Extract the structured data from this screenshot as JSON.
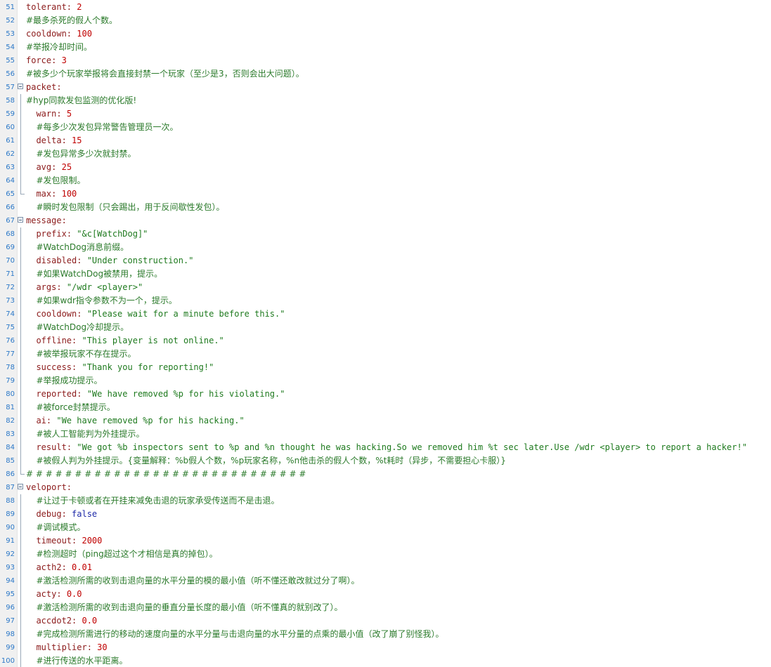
{
  "lines": [
    {
      "no": "51",
      "indent": "",
      "key": "tolerant",
      "val": "2",
      "vtype": "val"
    },
    {
      "no": "52",
      "indent": "",
      "comment": "#最多杀死的假人个数。"
    },
    {
      "no": "53",
      "indent": "",
      "key": "cooldown",
      "val": "100",
      "vtype": "val"
    },
    {
      "no": "54",
      "indent": "",
      "comment": "#举报冷却时间。"
    },
    {
      "no": "55",
      "indent": "",
      "key": "force",
      "val": "3",
      "vtype": "val"
    },
    {
      "no": "56",
      "indent": "",
      "comment": "#被多少个玩家举报将会直接封禁一个玩家（至少是3，否则会出大问题）。"
    },
    {
      "no": "57",
      "indent": "",
      "key": "packet",
      "val": "",
      "fold": "start"
    },
    {
      "no": "58",
      "indent": "",
      "comment": "#hyp同款发包监测的优化版!"
    },
    {
      "no": "59",
      "indent": "  ",
      "key": "warn",
      "val": "5",
      "vtype": "val"
    },
    {
      "no": "60",
      "indent": "  ",
      "comment": "#每多少次发包异常警告管理员一次。"
    },
    {
      "no": "61",
      "indent": "  ",
      "key": "delta",
      "val": "15",
      "vtype": "val"
    },
    {
      "no": "62",
      "indent": "  ",
      "comment": "#发包异常多少次就封禁。"
    },
    {
      "no": "63",
      "indent": "  ",
      "key": "avg",
      "val": "25",
      "vtype": "val"
    },
    {
      "no": "64",
      "indent": "  ",
      "comment": "#发包限制。"
    },
    {
      "no": "65",
      "indent": "  ",
      "key": "max",
      "val": "100",
      "vtype": "val",
      "fold": "end"
    },
    {
      "no": "66",
      "indent": "  ",
      "comment": "#瞬时发包限制（只会踢出，用于反间歇性发包）。"
    },
    {
      "no": "67",
      "indent": "",
      "key": "message",
      "val": "",
      "fold": "start"
    },
    {
      "no": "68",
      "indent": "  ",
      "key": "prefix",
      "val": "\"&c[WatchDog]\"",
      "vtype": "str"
    },
    {
      "no": "69",
      "indent": "  ",
      "comment": "#WatchDog消息前缀。"
    },
    {
      "no": "70",
      "indent": "  ",
      "key": "disabled",
      "val": "\"Under construction.\"",
      "vtype": "str"
    },
    {
      "no": "71",
      "indent": "  ",
      "comment": "#如果WatchDog被禁用，提示。"
    },
    {
      "no": "72",
      "indent": "  ",
      "key": "args",
      "val": "\"/wdr <player>\"",
      "vtype": "str"
    },
    {
      "no": "73",
      "indent": "  ",
      "comment": "#如果wdr指令参数不为一个，提示。"
    },
    {
      "no": "74",
      "indent": "  ",
      "key": "cooldown",
      "val": "\"Please wait for a minute before this.\"",
      "vtype": "str"
    },
    {
      "no": "75",
      "indent": "  ",
      "comment": "#WatchDog冷却提示。"
    },
    {
      "no": "76",
      "indent": "  ",
      "key": "offline",
      "val": "\"This player is not online.\"",
      "vtype": "str"
    },
    {
      "no": "77",
      "indent": "  ",
      "comment": "#被举报玩家不存在提示。"
    },
    {
      "no": "78",
      "indent": "  ",
      "key": "success",
      "val": "\"Thank you for reporting!\"",
      "vtype": "str"
    },
    {
      "no": "79",
      "indent": "  ",
      "comment": "#举报成功提示。"
    },
    {
      "no": "80",
      "indent": "  ",
      "key": "reported",
      "val": "\"We have removed %p for his violating.\"",
      "vtype": "str"
    },
    {
      "no": "81",
      "indent": "  ",
      "comment": "#被force封禁提示。"
    },
    {
      "no": "82",
      "indent": "  ",
      "key": "ai",
      "val": "\"We have removed %p for his hacking.\"",
      "vtype": "str"
    },
    {
      "no": "83",
      "indent": "  ",
      "comment": "#被人工智能判为外挂提示。"
    },
    {
      "no": "84",
      "indent": "  ",
      "key": "result",
      "val": "\"We got %b inspectors sent to %p and %n thought he was hacking.So we removed him %t sec later.Use /wdr <player> to report a hacker!\"",
      "vtype": "str"
    },
    {
      "no": "85",
      "indent": "  ",
      "comment": "#被假人判为外挂提示。{变量解释：%b假人个数，%p玩家名称，%n他击杀的假人个数，%t耗时（异步，不需要担心卡服）}"
    },
    {
      "no": "86",
      "indent": "",
      "comment": "# # # # # # # # # # # # # # # # # # # # # # # # # # # # #",
      "fold": "end"
    },
    {
      "no": "87",
      "indent": "",
      "key": "veloport",
      "val": "",
      "fold": "start"
    },
    {
      "no": "88",
      "indent": "  ",
      "comment": "#让过于卡顿或者在开挂来减免击退的玩家承受传送而不是击退。"
    },
    {
      "no": "89",
      "indent": "  ",
      "key": "debug",
      "val": "false",
      "vtype": "kw"
    },
    {
      "no": "90",
      "indent": "  ",
      "comment": "#调试模式。"
    },
    {
      "no": "91",
      "indent": "  ",
      "key": "timeout",
      "val": "2000",
      "vtype": "val"
    },
    {
      "no": "92",
      "indent": "  ",
      "comment": "#检测超时（ping超过这个才相信是真的掉包）。"
    },
    {
      "no": "93",
      "indent": "  ",
      "key": "acth2",
      "val": "0.01",
      "vtype": "val"
    },
    {
      "no": "94",
      "indent": "  ",
      "comment": "#激活检测所需的收到击退向量的水平分量的模的最小值（听不懂还敢改就过分了啊）。"
    },
    {
      "no": "95",
      "indent": "  ",
      "key": "acty",
      "val": "0.0",
      "vtype": "val"
    },
    {
      "no": "96",
      "indent": "  ",
      "comment": "#激活检测所需的收到击退向量的垂直分量长度的最小值（听不懂真的就别改了）。"
    },
    {
      "no": "97",
      "indent": "  ",
      "key": "accdot2",
      "val": "0.0",
      "vtype": "val"
    },
    {
      "no": "98",
      "indent": "  ",
      "comment": "#完成检测所需进行的移动的速度向量的水平分量与击退向量的水平分量的点乘的最小值（改了崩了别怪我）。"
    },
    {
      "no": "99",
      "indent": "  ",
      "key": "multiplier",
      "val": "30",
      "vtype": "val"
    },
    {
      "no": "100",
      "indent": "  ",
      "comment": "#进行传送的水平距离。"
    }
  ]
}
